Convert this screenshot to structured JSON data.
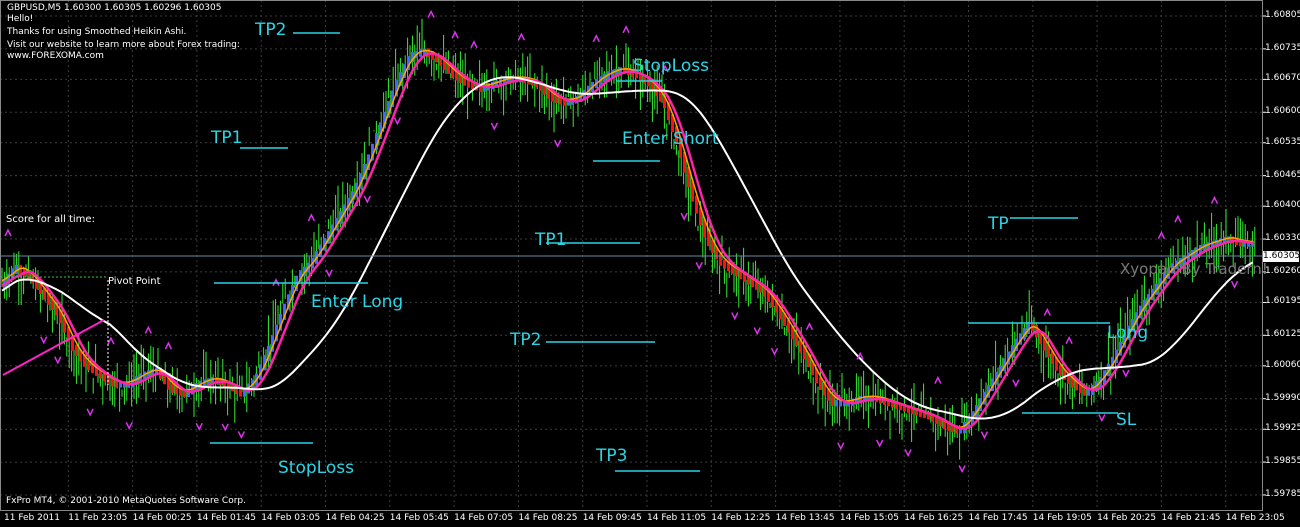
{
  "header": {
    "symbol_line": "GBPUSD,M5  1.60300 1.60305 1.60296 1.60305",
    "hello": "Hello!",
    "thanks": "Thanks for using Smoothed Heikin Ashi.",
    "visit": "Visit our website to learn more about Forex trading:",
    "site": "www.FOREXOMA.com"
  },
  "score_label": "Score for all time:",
  "pivot_label": "Pivot Point",
  "copyright": "FxPro MT4, © 2001-2010 MetaQuotes Software Corp.",
  "watermark": "Xyopan By Tradern!",
  "current_price": "1.60305",
  "chart_data": {
    "type": "line",
    "symbol": "GBPUSD",
    "timeframe": "M5",
    "ylim": [
      1.5978,
      1.60815
    ],
    "y_ticks": [
      "1.60805",
      "1.60735",
      "1.60670",
      "1.60600",
      "1.60535",
      "1.60465",
      "1.60400",
      "1.60330",
      "1.60260",
      "1.60195",
      "1.60125",
      "1.60060",
      "1.59990",
      "1.59925",
      "1.59855",
      "1.59785"
    ],
    "x_ticks": [
      "11 Feb 2011",
      "11 Feb 23:05",
      "14 Feb 00:25",
      "14 Feb 01:45",
      "14 Feb 03:05",
      "14 Feb 04:25",
      "14 Feb 05:45",
      "14 Feb 07:05",
      "14 Feb 08:25",
      "14 Feb 09:45",
      "14 Feb 11:05",
      "14 Feb 12:25",
      "14 Feb 13:45",
      "14 Feb 15:05",
      "14 Feb 16:25",
      "14 Feb 17:45",
      "14 Feb 19:05",
      "14 Feb 20:25",
      "14 Feb 21:45",
      "14 Feb 23:05"
    ],
    "grid": true,
    "close_approx": [
      1.6023,
      1.6027,
      1.6025,
      1.6021,
      1.6017,
      1.601,
      1.6006,
      1.6004,
      1.6002,
      1.6002,
      1.6004,
      1.6005,
      1.6001,
      1.6,
      1.6002,
      1.6003,
      1.6002,
      1.6,
      1.6003,
      1.601,
      1.6018,
      1.6025,
      1.6028,
      1.6033,
      1.6038,
      1.6043,
      1.605,
      1.6058,
      1.6066,
      1.6072,
      1.6073,
      1.6071,
      1.6068,
      1.6066,
      1.6065,
      1.6066,
      1.6067,
      1.6067,
      1.6066,
      1.6063,
      1.6062,
      1.6063,
      1.6066,
      1.6068,
      1.6069,
      1.6068,
      1.6066,
      1.6062,
      1.6053,
      1.6042,
      1.6033,
      1.6028,
      1.6026,
      1.6024,
      1.6022,
      1.6018,
      1.6013,
      1.6008,
      1.6002,
      1.5998,
      1.5998,
      1.5999,
      1.5999,
      1.5998,
      1.5997,
      1.5996,
      1.5995,
      1.5993,
      1.5992,
      1.5996,
      1.6001,
      1.6006,
      1.6011,
      1.6015,
      1.601,
      1.6005,
      1.6002,
      1.6,
      1.6003,
      1.6008,
      1.6014,
      1.6019,
      1.6023,
      1.6027,
      1.6029,
      1.6031,
      1.6032,
      1.6033,
      1.6032,
      1.6032
    ],
    "annotations": [
      {
        "text": "TP2",
        "x": "14 Feb 03:05",
        "y": 1.6076
      },
      {
        "text": "TP1",
        "x": "14 Feb 01:45",
        "y": 1.6055
      },
      {
        "text": "Enter Long",
        "x": "14 Feb 04:25",
        "y": 1.60255
      },
      {
        "text": "StopLoss",
        "x": "14 Feb 03:05",
        "y": 1.59935
      },
      {
        "text": "StopLoss",
        "x": "14 Feb 09:45",
        "y": 1.60715
      },
      {
        "text": "Enter Short",
        "x": "14 Feb 09:45",
        "y": 1.6052
      },
      {
        "text": "TP1",
        "x": "14 Feb 08:25",
        "y": 1.6035
      },
      {
        "text": "TP2",
        "x": "14 Feb 08:25",
        "y": 1.6015
      },
      {
        "text": "TP3",
        "x": "14 Feb 09:45",
        "y": 1.59875
      },
      {
        "text": "TP",
        "x": "14 Feb 19:05",
        "y": 1.604
      },
      {
        "text": "Long",
        "x": "14 Feb 20:25",
        "y": 1.60195
      },
      {
        "text": "SL",
        "x": "14 Feb 20:25",
        "y": 1.59985
      }
    ],
    "colors": {
      "background": "#000000",
      "grid": "#3c3c3c",
      "candles": "#33ee33",
      "ha_bull": "#4466ff",
      "ha_bear": "#ff1010",
      "ma_fast": "#ff22aa",
      "ma_orange": "#ffa500",
      "ma_slow": "#ffffff",
      "arrows": "#dd33ee",
      "annotation": "#29d6e6"
    }
  }
}
